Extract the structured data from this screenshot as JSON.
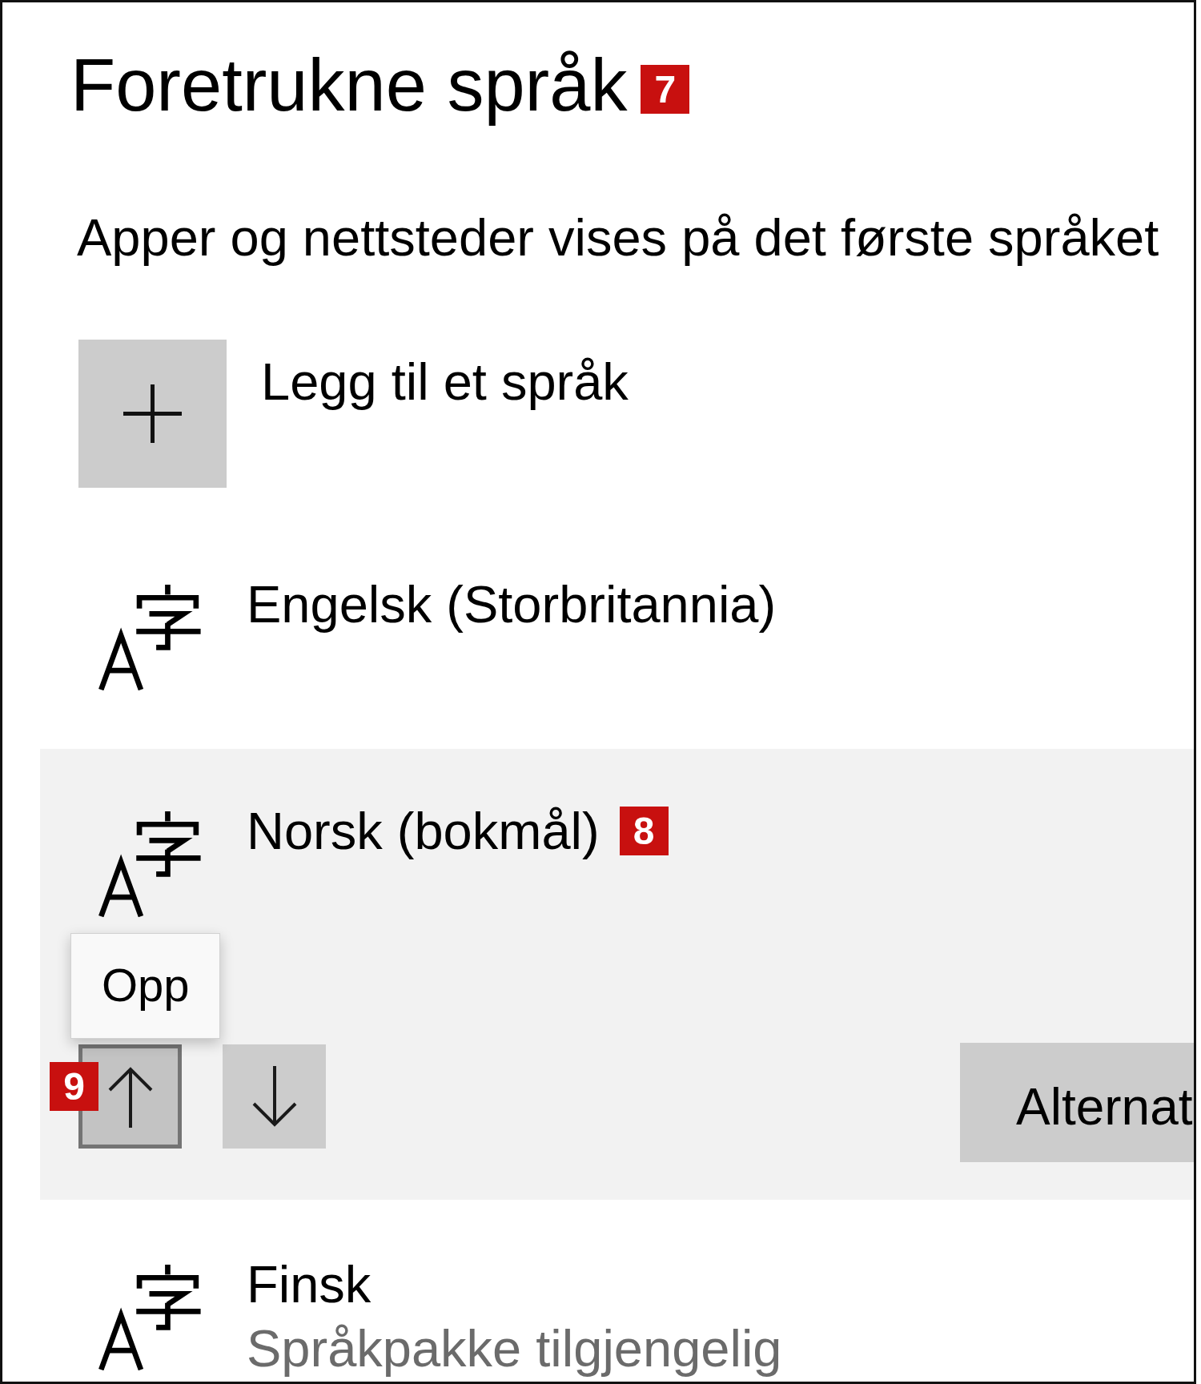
{
  "heading": {
    "text": "Foretrukne språk",
    "marker": "7"
  },
  "description": "Apper og nettsteder vises på det første språket",
  "add_language": {
    "label": "Legg til et språk"
  },
  "languages": [
    {
      "name": "Engelsk (Storbritannia)",
      "selected": false
    },
    {
      "name": "Norsk (bokmål)",
      "marker": "8",
      "selected": true,
      "controls": {
        "buttons": [
          {
            "kind": "up",
            "hovered": true,
            "tooltip": "Opp",
            "marker": "9"
          },
          {
            "kind": "down",
            "hovered": false
          }
        ],
        "options_label": "Alternat"
      }
    },
    {
      "name": "Finsk",
      "status": "Språkpakke tilgjengelig",
      "selected": false
    }
  ]
}
